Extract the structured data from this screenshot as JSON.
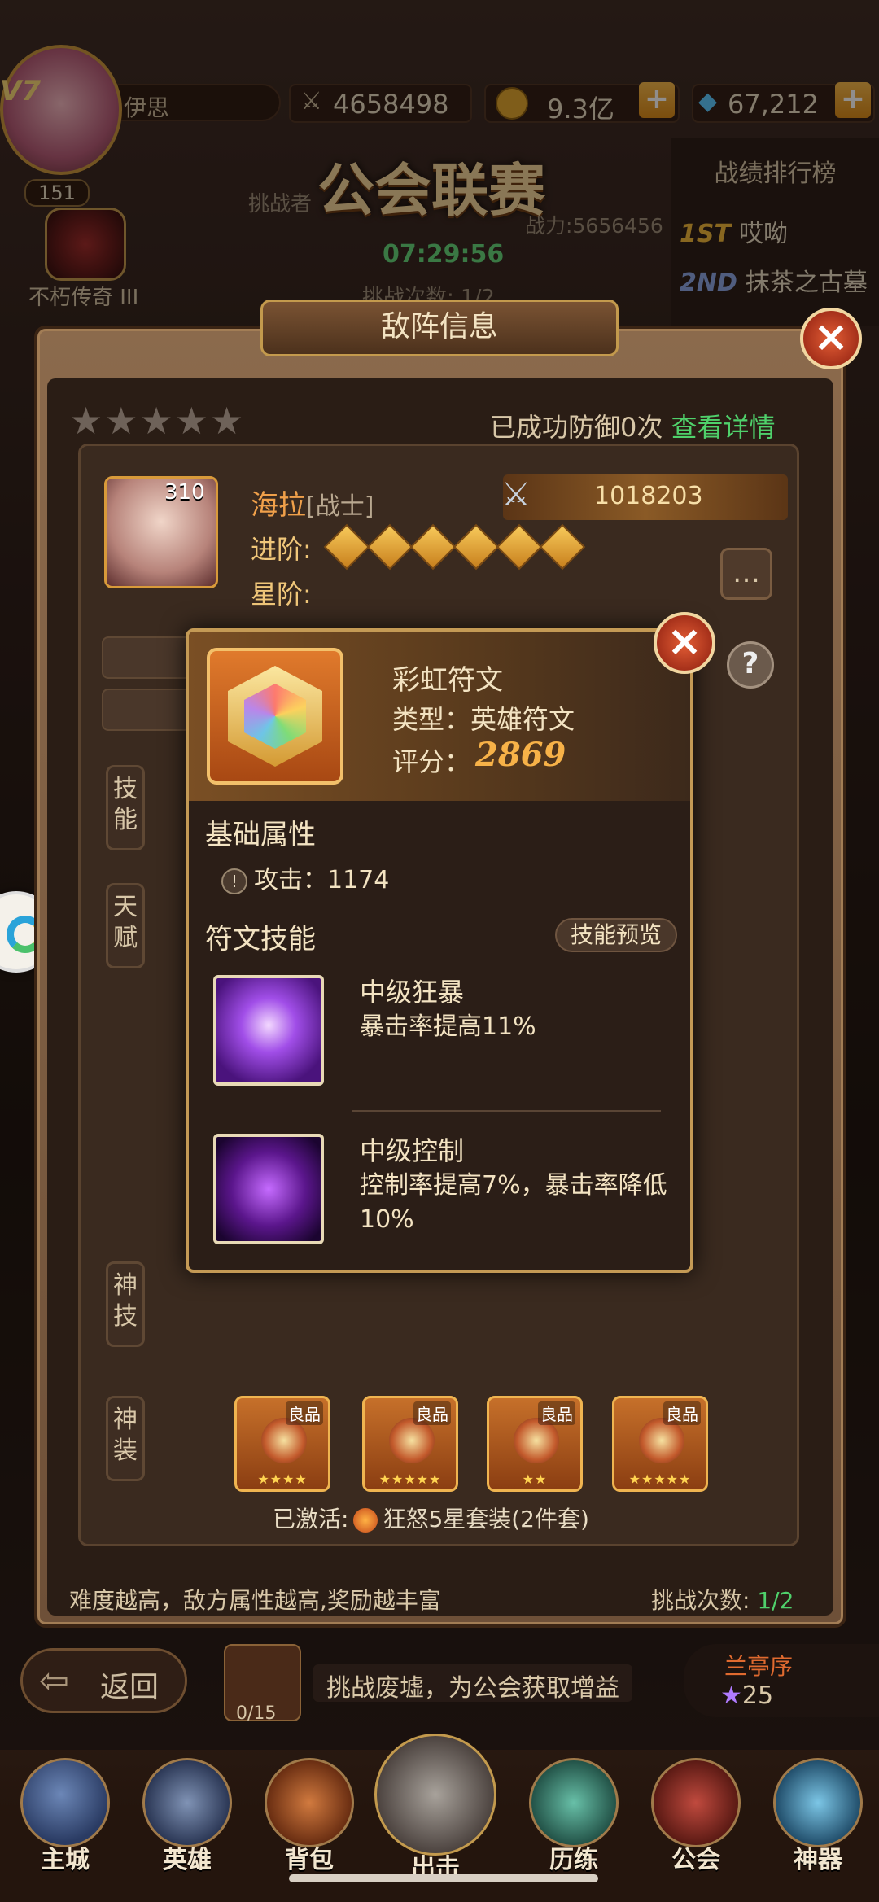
{
  "topbar": {
    "player_name": "伊思",
    "power": "4658498",
    "gold": "9.3亿",
    "gems": "67,212",
    "vip": "V7",
    "avatar_level": "151",
    "rank_title": "不朽传奇 III"
  },
  "event": {
    "title": "公会联赛",
    "challenge_label": "挑战者",
    "power": "战力:5656456",
    "timer": "07:29:56",
    "count": "挑战次数: 1/2"
  },
  "ranking": {
    "title": "战绩排行榜",
    "rows": [
      {
        "rank": "1ST",
        "name": "哎呦"
      },
      {
        "rank": "2ND",
        "name": "抹茶之古墓"
      }
    ]
  },
  "panel": {
    "title": "敌阵信息",
    "defense_text": "已成功防御0次",
    "detail_link": "查看详情",
    "hero": {
      "level": "310",
      "name": "海拉",
      "class": "[战士]",
      "power": "1018203",
      "adv_label": "进阶:",
      "star_label": "星阶:"
    },
    "tabs": [
      "技能",
      "天赋",
      "神技",
      "神装"
    ],
    "equip": [
      {
        "tag": "良品",
        "stars": "★★★★"
      },
      {
        "tag": "良品",
        "stars": "★★★★★"
      },
      {
        "tag": "良品",
        "stars": "★★"
      },
      {
        "tag": "良品",
        "stars": "★★★★★"
      }
    ],
    "set_label": "已激活:",
    "set_value": "狂怒5星套装(2件套)",
    "footer_hint": "难度越高，敌方属性越高,奖励越丰富",
    "footer_count_label": "挑战次数:",
    "footer_count_value": "1/2"
  },
  "rune": {
    "name": "彩虹符文",
    "type": "类型：英雄符文",
    "score_label": "评分：",
    "score": "2869",
    "base_title": "基础属性",
    "attr": "攻击：1174",
    "skills_title": "符文技能",
    "preview_label": "技能预览",
    "skills": [
      {
        "name": "中级狂暴",
        "desc": "暴击率提高11%"
      },
      {
        "name": "中级控制",
        "desc": "控制率提高7%，暴击率降低10%"
      }
    ]
  },
  "bottom": {
    "back": "返回",
    "quest_progress": "0/15",
    "quest_text": "挑战废墟，为公会获取增益",
    "team_name": "兰亭序",
    "team_score": "25"
  },
  "nav": [
    "主城",
    "英雄",
    "背包",
    "出击",
    "历练",
    "公会",
    "神器"
  ],
  "icons": [
    "power-icon",
    "gold-coin-icon",
    "diamond-icon",
    "close-icon",
    "chat-icon",
    "help-icon",
    "sword-icon",
    "rune-icon"
  ]
}
